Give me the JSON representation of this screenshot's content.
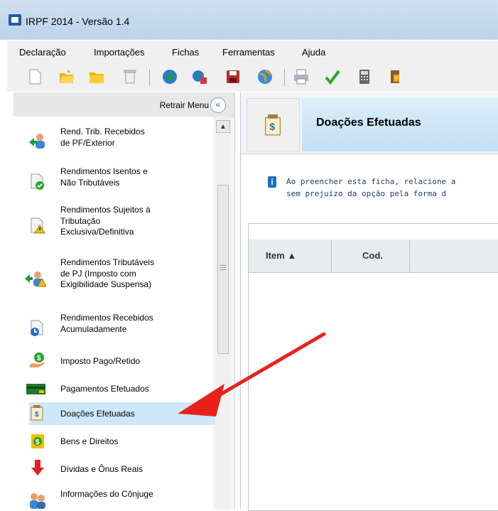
{
  "window": {
    "title": "IRPF 2014 - Versão 1.4"
  },
  "menubar": {
    "items": [
      "Declaração",
      "Importações",
      "Fichas",
      "Ferramentas",
      "Ajuda"
    ]
  },
  "toolbar": {
    "buttons": [
      "new-document-icon",
      "open-folder-icon",
      "folder-icon",
      "delete-icon",
      "transmit-icon",
      "receipt-icon",
      "save-icon",
      "globe-icon",
      "print-icon",
      "check-icon",
      "calculator-icon",
      "help-icon"
    ]
  },
  "sidebar": {
    "collapse_label": "Retrair Menu",
    "collapse_symbol": "«",
    "items": [
      {
        "lines": [
          "Rend. Trib. Recebidos",
          "de PF/Exterior"
        ]
      },
      {
        "lines": [
          "Rendimentos Isentos e",
          "Não Tributáveis"
        ]
      },
      {
        "lines": [
          "Rendimentos Sujeitos à",
          "Tributação",
          "Exclusiva/Definitiva"
        ]
      },
      {
        "lines": [
          "Rendimentos Tributáveis",
          "de PJ (Imposto com",
          "Exigibilidade Suspensa)"
        ]
      },
      {
        "lines": [
          "Rendimentos Recebidos",
          "Acumuladamente"
        ]
      },
      {
        "lines": [
          "Imposto Pago/Retido"
        ]
      },
      {
        "lines": [
          "Pagamentos Efetuados"
        ]
      },
      {
        "lines": [
          "Doações Efetuadas"
        ]
      },
      {
        "lines": [
          "Bens e Direitos"
        ]
      },
      {
        "lines": [
          "Dívidas e Ônus Reais"
        ]
      },
      {
        "lines": [
          "Informações do Cônjuge"
        ]
      }
    ],
    "selected_index": 7
  },
  "main": {
    "title": "Doações Efetuadas",
    "info": [
      "Ao preencher esta ficha, relacione a",
      "sem prejuízo da opção pela forma d"
    ],
    "table": {
      "columns": [
        "Item ▲",
        "Cod."
      ]
    }
  },
  "annotation": {
    "arrow_color": "#e8221b"
  }
}
